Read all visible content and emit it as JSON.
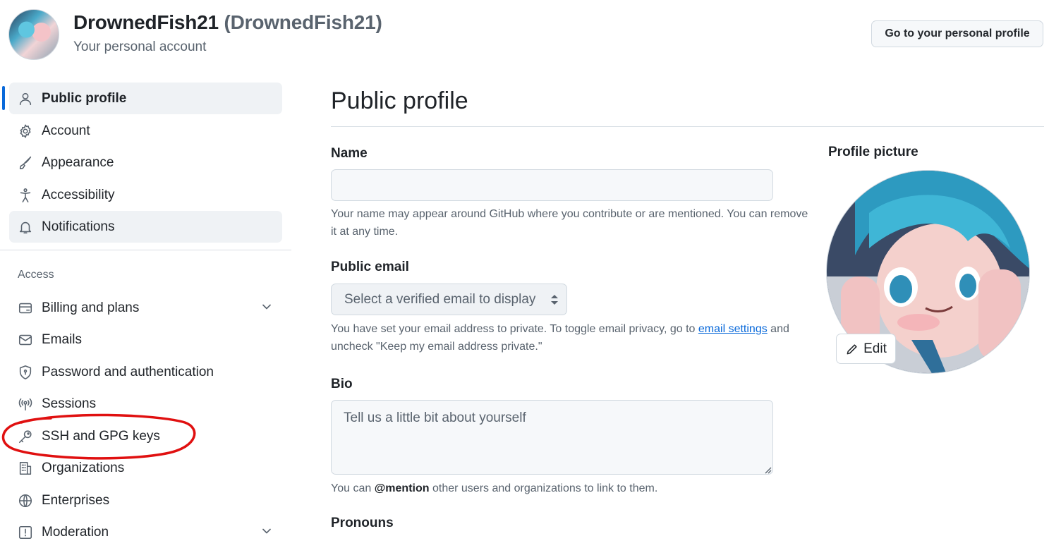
{
  "header": {
    "display_name": "DrownedFish21",
    "handle": "(DrownedFish21)",
    "subtitle": "Your personal account",
    "profile_button": "Go to your personal profile"
  },
  "sidebar": {
    "items": [
      {
        "label": "Public profile",
        "icon": "person-icon"
      },
      {
        "label": "Account",
        "icon": "gear-icon"
      },
      {
        "label": "Appearance",
        "icon": "paintbrush-icon"
      },
      {
        "label": "Accessibility",
        "icon": "accessibility-icon"
      },
      {
        "label": "Notifications",
        "icon": "bell-icon"
      }
    ],
    "access_label": "Access",
    "access_items": [
      {
        "label": "Billing and plans",
        "icon": "credit-card-icon"
      },
      {
        "label": "Emails",
        "icon": "mail-icon"
      },
      {
        "label": "Password and authentication",
        "icon": "shield-lock-icon"
      },
      {
        "label": "Sessions",
        "icon": "broadcast-icon"
      },
      {
        "label": "SSH and GPG keys",
        "icon": "key-icon"
      },
      {
        "label": "Organizations",
        "icon": "organization-icon"
      },
      {
        "label": "Enterprises",
        "icon": "globe-icon"
      },
      {
        "label": "Moderation",
        "icon": "report-icon"
      }
    ]
  },
  "main": {
    "title": "Public profile",
    "name": {
      "label": "Name",
      "value": "",
      "help": "Your name may appear around GitHub where you contribute or are mentioned. You can remove it at any time."
    },
    "public_email": {
      "label": "Public email",
      "selected": "Select a verified email to display",
      "help_prefix": "You have set your email address to private. To toggle email privacy, go to",
      "help_link": "email settings",
      "help_suffix": "and uncheck \"Keep my email address private.\""
    },
    "bio": {
      "label": "Bio",
      "placeholder": "Tell us a little bit about yourself",
      "help_prefix": "You can",
      "help_mention": "@mention",
      "help_suffix": "other users and organizations to link to them."
    },
    "pronouns": {
      "label": "Pronouns"
    }
  },
  "profile_picture": {
    "label": "Profile picture",
    "edit_label": "Edit"
  },
  "colors": {
    "accent": "#0969da",
    "annotation": "#e01010"
  }
}
